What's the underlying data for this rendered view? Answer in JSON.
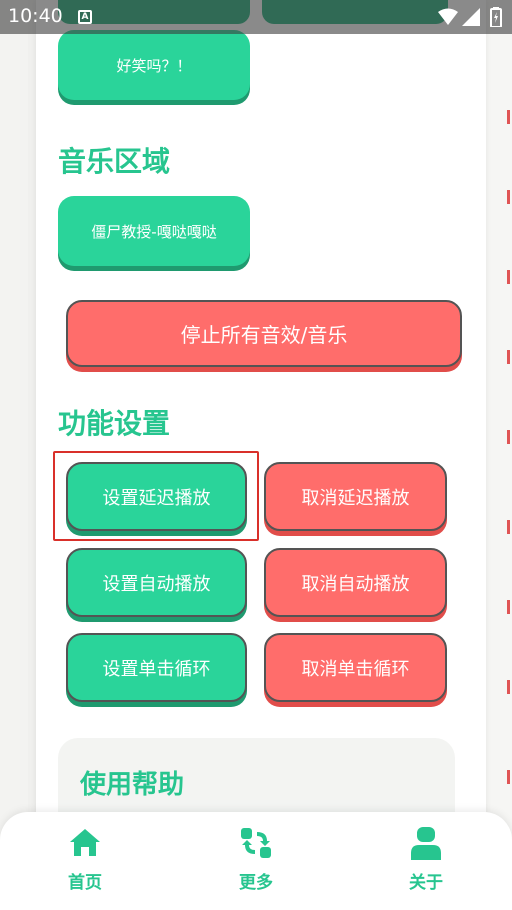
{
  "status_bar": {
    "time": "10:40",
    "notification_letter": "A",
    "icons": [
      "wifi-icon",
      "signal-icon",
      "battery-icon"
    ]
  },
  "top_button": {
    "label": "好笑吗？！"
  },
  "music_section": {
    "title": "音乐区域",
    "track_button": "僵尸教授-嘎哒嘎哒",
    "stop_all_button": "停止所有音效/音乐"
  },
  "function_section": {
    "title": "功能设置",
    "buttons": [
      {
        "label": "设置延迟播放",
        "variant": "green"
      },
      {
        "label": "取消延迟播放",
        "variant": "red"
      },
      {
        "label": "设置自动播放",
        "variant": "green"
      },
      {
        "label": "取消自动播放",
        "variant": "red"
      },
      {
        "label": "设置单击循环",
        "variant": "green"
      },
      {
        "label": "取消单击循环",
        "variant": "red"
      }
    ]
  },
  "help_section": {
    "title": "使用帮助"
  },
  "bottom_nav": {
    "items": [
      {
        "label": "首页",
        "icon": "home-icon"
      },
      {
        "label": "更多",
        "icon": "refresh-icon"
      },
      {
        "label": "关于",
        "icon": "user-icon"
      }
    ]
  },
  "colors": {
    "accent_green": "#2ad49a",
    "title_green": "#27c58f",
    "danger_red": "#ff6d6b",
    "highlight_red": "#d9302a"
  }
}
